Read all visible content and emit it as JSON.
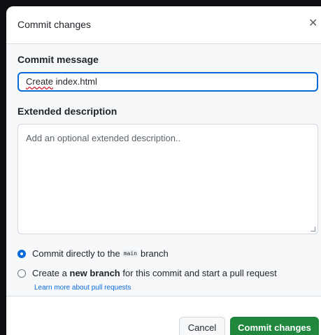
{
  "dialog": {
    "title": "Commit changes",
    "close_icon": "close-icon"
  },
  "form": {
    "message_label": "Commit message",
    "message_value_word1": "Create",
    "message_value_rest": " index.html",
    "description_label": "Extended description",
    "description_placeholder": "Add an optional extended description.."
  },
  "options": {
    "direct_prefix": "Commit directly to the",
    "direct_branch": "main",
    "direct_suffix": "branch",
    "direct_selected": true,
    "new_prefix": "Create a",
    "new_bold": "new branch",
    "new_suffix": "for this commit and start a pull request",
    "learn_more": "Learn more about pull requests"
  },
  "footer": {
    "cancel_label": "Cancel",
    "commit_label": "Commit changes"
  },
  "colors": {
    "primary_button": "#1f883d",
    "focus_blue": "#0969da"
  }
}
